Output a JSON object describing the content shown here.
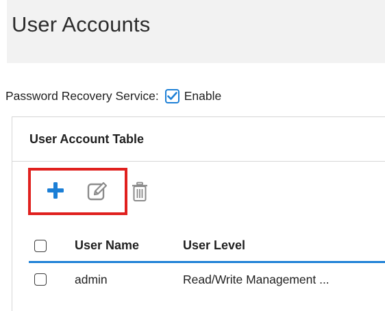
{
  "page": {
    "title": "User Accounts"
  },
  "password_recovery": {
    "label": "Password Recovery Service:",
    "checkbox_label": "Enable",
    "checked": true
  },
  "user_account_table": {
    "title": "User Account Table",
    "toolbar": {
      "add_icon": "plus-icon",
      "edit_icon": "edit-icon",
      "delete_icon": "trash-icon",
      "highlight_color": "#e0201e"
    },
    "columns": [
      "User Name",
      "User Level"
    ],
    "rows": [
      {
        "user_name": "admin",
        "user_level": "Read/Write Management ..."
      }
    ]
  },
  "colors": {
    "accent": "#1c7fd6",
    "header_band": "#f2f2f2"
  }
}
